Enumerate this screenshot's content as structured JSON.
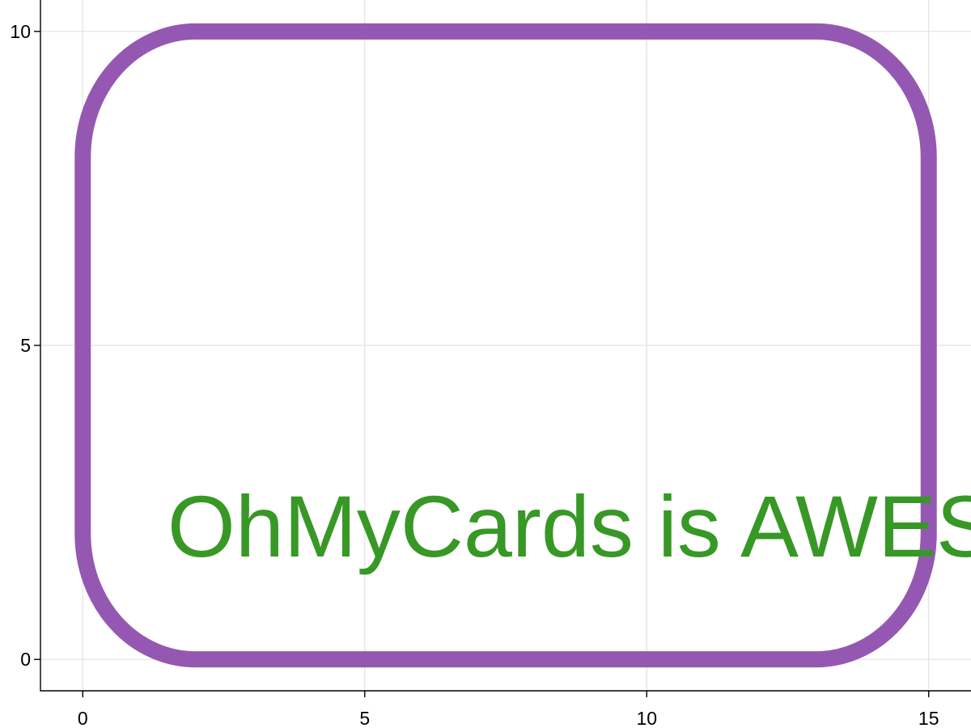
{
  "chart_data": {
    "type": "line",
    "title": "",
    "xlabel": "",
    "ylabel": "",
    "xlim": [
      -0.75,
      15.75
    ],
    "ylim": [
      -0.5,
      10.5
    ],
    "x_ticks": [
      0,
      5,
      10,
      15
    ],
    "y_ticks": [
      0,
      5,
      10
    ],
    "x_tick_labels": [
      "0",
      "5",
      "10",
      "15"
    ],
    "y_tick_labels": [
      "0",
      "5",
      "10"
    ],
    "grid": true,
    "series": [
      {
        "shape": "rounded-rectangle",
        "x_range": [
          0,
          15
        ],
        "y_range": [
          0,
          10
        ],
        "corner_radius": 2,
        "color": "#9558b2"
      }
    ],
    "annotations": [
      {
        "text": "OhMyCards is AWESOME!",
        "x": 1.5,
        "y": 2,
        "color": "#389826"
      }
    ]
  }
}
